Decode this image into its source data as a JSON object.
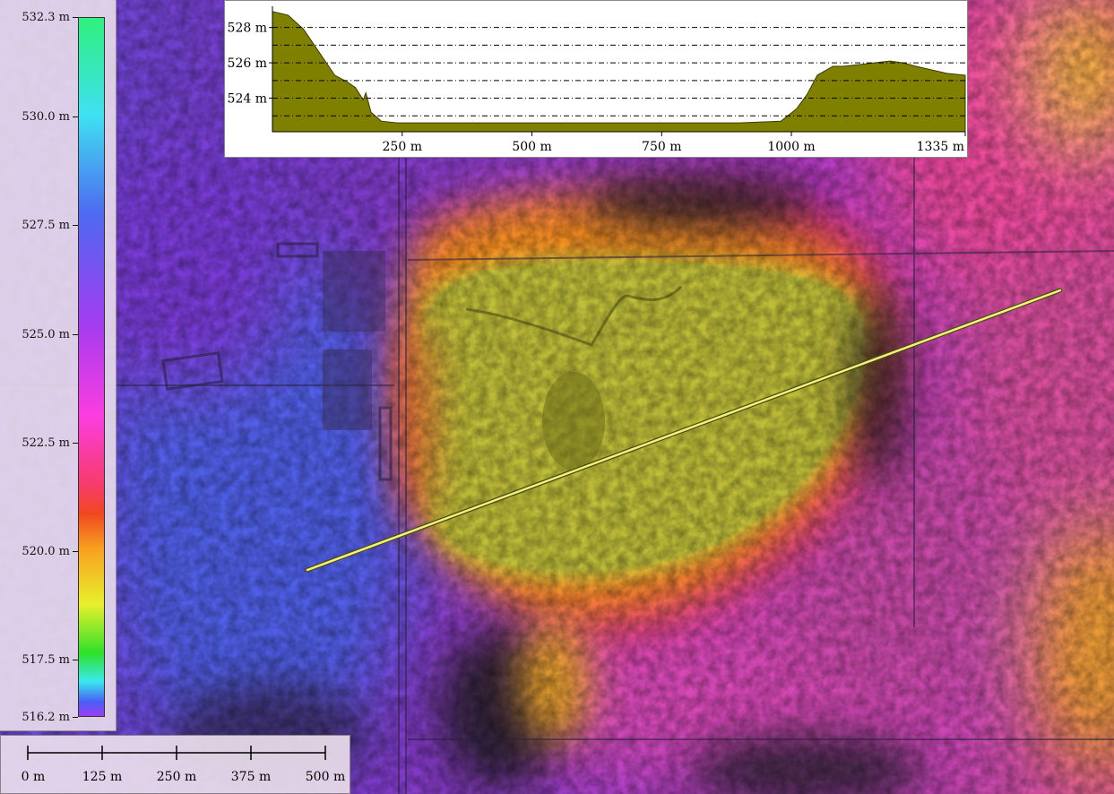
{
  "legend": {
    "ticks": [
      {
        "label": "532.3 m",
        "value": 532.3
      },
      {
        "label": "530.0 m",
        "value": 530.0
      },
      {
        "label": "527.5 m",
        "value": 527.5
      },
      {
        "label": "525.0 m",
        "value": 525.0
      },
      {
        "label": "522.5 m",
        "value": 522.5
      },
      {
        "label": "520.0 m",
        "value": 520.0
      },
      {
        "label": "517.5 m",
        "value": 517.5
      },
      {
        "label": "516.2 m",
        "value": 516.2
      }
    ],
    "min": 516.2,
    "max": 532.3
  },
  "chart_data": {
    "type": "area",
    "x_ticks": [
      "250 m",
      "500 m",
      "750 m",
      "1000 m",
      "1335 m"
    ],
    "x_tick_values": [
      250,
      500,
      750,
      1000,
      1335
    ],
    "y_ticks": [
      "528 m",
      "526 m",
      "524 m"
    ],
    "y_tick_values": [
      528,
      526,
      524
    ],
    "xlim": [
      0,
      1335
    ],
    "ylim": [
      522.1,
      529.2
    ],
    "grid": "horizontal dash-dot",
    "fill_color": "#808000",
    "x": [
      0,
      30,
      60,
      90,
      120,
      145,
      160,
      175,
      180,
      190,
      210,
      240,
      300,
      400,
      500,
      600,
      700,
      800,
      900,
      980,
      1010,
      1030,
      1050,
      1080,
      1100,
      1130,
      1160,
      1190,
      1215,
      1240,
      1270,
      1300,
      1335
    ],
    "y": [
      528.9,
      528.7,
      527.9,
      526.6,
      525.3,
      524.9,
      524.6,
      523.9,
      524.3,
      523.2,
      522.7,
      522.6,
      522.6,
      522.6,
      522.6,
      522.6,
      522.6,
      522.6,
      522.6,
      522.7,
      523.4,
      524.2,
      525.3,
      525.8,
      525.8,
      525.9,
      526.0,
      526.1,
      526.0,
      525.8,
      525.6,
      525.4,
      525.3
    ]
  },
  "transect": {
    "color": "#f2f080"
  },
  "scale_bar": {
    "labels": [
      "0 m",
      "125 m",
      "250 m",
      "375 m",
      "500 m"
    ],
    "values": [
      0,
      125,
      250,
      375,
      500
    ]
  }
}
